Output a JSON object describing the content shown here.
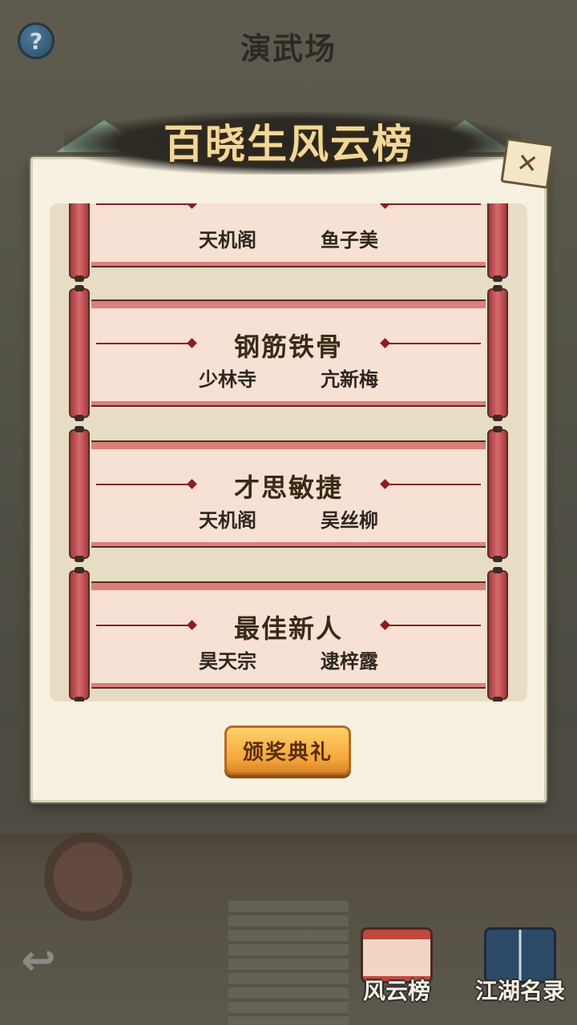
{
  "header": {
    "title": "演武场",
    "help_label": "?"
  },
  "dialog": {
    "title": "百晓生风云榜",
    "close_label": "✕",
    "awards": [
      {
        "title": "",
        "entries": [
          "天机阁",
          "鱼子美"
        ]
      },
      {
        "title": "钢筋铁骨",
        "entries": [
          "少林寺",
          "亢新梅"
        ]
      },
      {
        "title": "才思敏捷",
        "entries": [
          "天机阁",
          "吴丝柳"
        ]
      },
      {
        "title": "最佳新人",
        "entries": [
          "昊天宗",
          "逮梓露"
        ]
      }
    ],
    "ceremony_button": "颁奖典礼"
  },
  "bottom_nav": {
    "back_label": "↩",
    "items": [
      {
        "label": "风云榜",
        "icon": "scroll-icon"
      },
      {
        "label": "江湖名录",
        "icon": "book-icon"
      }
    ]
  },
  "colors": {
    "panel_bg": "#f7f1e1",
    "scroll_red": "#d9807a",
    "button_orange": "#f4a63a"
  }
}
